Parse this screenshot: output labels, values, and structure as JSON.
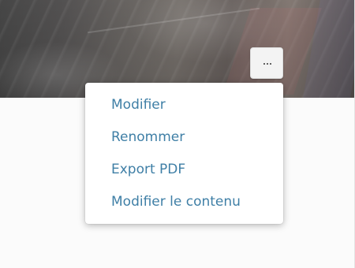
{
  "more_button": {
    "icon": "more-horizontal-icon"
  },
  "context_menu": {
    "items": [
      {
        "label": "Modifier"
      },
      {
        "label": "Renommer"
      },
      {
        "label": "Export PDF"
      },
      {
        "label": "Modifier le contenu"
      }
    ]
  },
  "colors": {
    "menu_text": "#3f7fa6",
    "menu_background": "#ffffff",
    "button_background": "#f3f3f3"
  }
}
